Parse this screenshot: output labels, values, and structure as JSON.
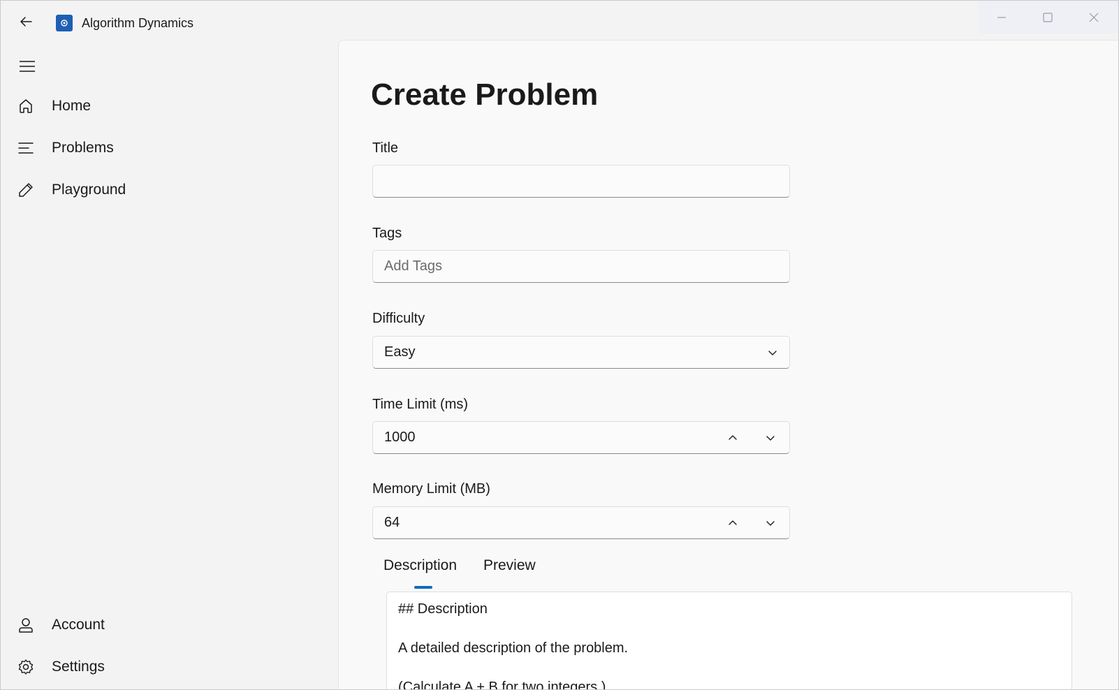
{
  "titlebar": {
    "app_title": "Algorithm Dynamics",
    "back_icon": "back-arrow-icon",
    "app_icon": "algorithm-dynamics-logo",
    "controls": [
      "minimize-icon",
      "maximize-icon",
      "close-icon"
    ]
  },
  "nav": {
    "menu_icon": "hamburger-menu-icon",
    "top_items": [
      {
        "label": "Home",
        "icon": "home-icon"
      },
      {
        "label": "Problems",
        "icon": "list-icon"
      },
      {
        "label": "Playground",
        "icon": "pencil-icon"
      }
    ],
    "bottom_items": [
      {
        "label": "Account",
        "icon": "person-icon"
      },
      {
        "label": "Settings",
        "icon": "gear-icon"
      }
    ]
  },
  "page": {
    "title": "Create Problem",
    "title_field": {
      "label": "Title",
      "value": "",
      "placeholder": ""
    },
    "tags_field": {
      "label": "Tags",
      "value": "",
      "placeholder": "Add Tags"
    },
    "difficulty": {
      "label": "Difficulty",
      "selected": "Easy"
    },
    "time_limit": {
      "label": "Time Limit (ms)",
      "value": "1000"
    },
    "memory_limit": {
      "label": "Memory Limit (MB)",
      "value": "64"
    },
    "tabs": [
      {
        "label": "Description",
        "selected": true
      },
      {
        "label": "Preview",
        "selected": false
      }
    ],
    "editor_lines": [
      "## Description",
      "",
      "A detailed description of the problem.",
      "",
      "(Calculate A + B for two integers.)"
    ]
  },
  "colors": {
    "accent": "#0f6cbd",
    "app_icon_bg": "#1e5fb4",
    "window_bg": "#f3f3f3",
    "content_bg": "#f9f9f9"
  }
}
